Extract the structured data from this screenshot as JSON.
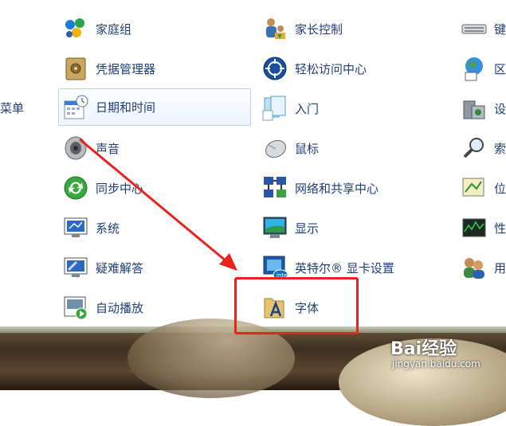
{
  "left_column_label": "菜单",
  "items": [
    {
      "label": "家庭组",
      "icon": "homegroup-icon"
    },
    {
      "label": "家长控制",
      "icon": "parental-control-icon"
    },
    {
      "label": "键",
      "icon": "keyboard-icon"
    },
    {
      "label": "凭据管理器",
      "icon": "credential-vault-icon"
    },
    {
      "label": "轻松访问中心",
      "icon": "ease-of-access-icon"
    },
    {
      "label": "区",
      "icon": "globe-icon"
    },
    {
      "label": "日期和时间",
      "icon": "calendar-clock-icon"
    },
    {
      "label": "入门",
      "icon": "getting-started-icon"
    },
    {
      "label": "设",
      "icon": "device-icon"
    },
    {
      "label": "声音",
      "icon": "speaker-icon"
    },
    {
      "label": "鼠标",
      "icon": "mouse-icon"
    },
    {
      "label": "索",
      "icon": "search-icon"
    },
    {
      "label": "同步中心",
      "icon": "sync-icon"
    },
    {
      "label": "网络和共享中心",
      "icon": "network-icon"
    },
    {
      "label": "位",
      "icon": "location-icon"
    },
    {
      "label": "系统",
      "icon": "system-monitor-icon"
    },
    {
      "label": "显示",
      "icon": "display-icon"
    },
    {
      "label": "性",
      "icon": "performance-icon"
    },
    {
      "label": "疑难解答",
      "icon": "troubleshoot-icon"
    },
    {
      "label": "英特尔® 显卡设置",
      "icon": "intel-graphics-icon"
    },
    {
      "label": "用",
      "icon": "users-icon"
    },
    {
      "label": "自动播放",
      "icon": "autoplay-icon"
    },
    {
      "label": "字体",
      "icon": "font-folder-icon"
    }
  ],
  "watermark": {
    "brand": "Bai经验",
    "url": "jingyan.baidu.com"
  },
  "colors": {
    "link": "#1e3e78",
    "highlight": "#e8231e"
  }
}
